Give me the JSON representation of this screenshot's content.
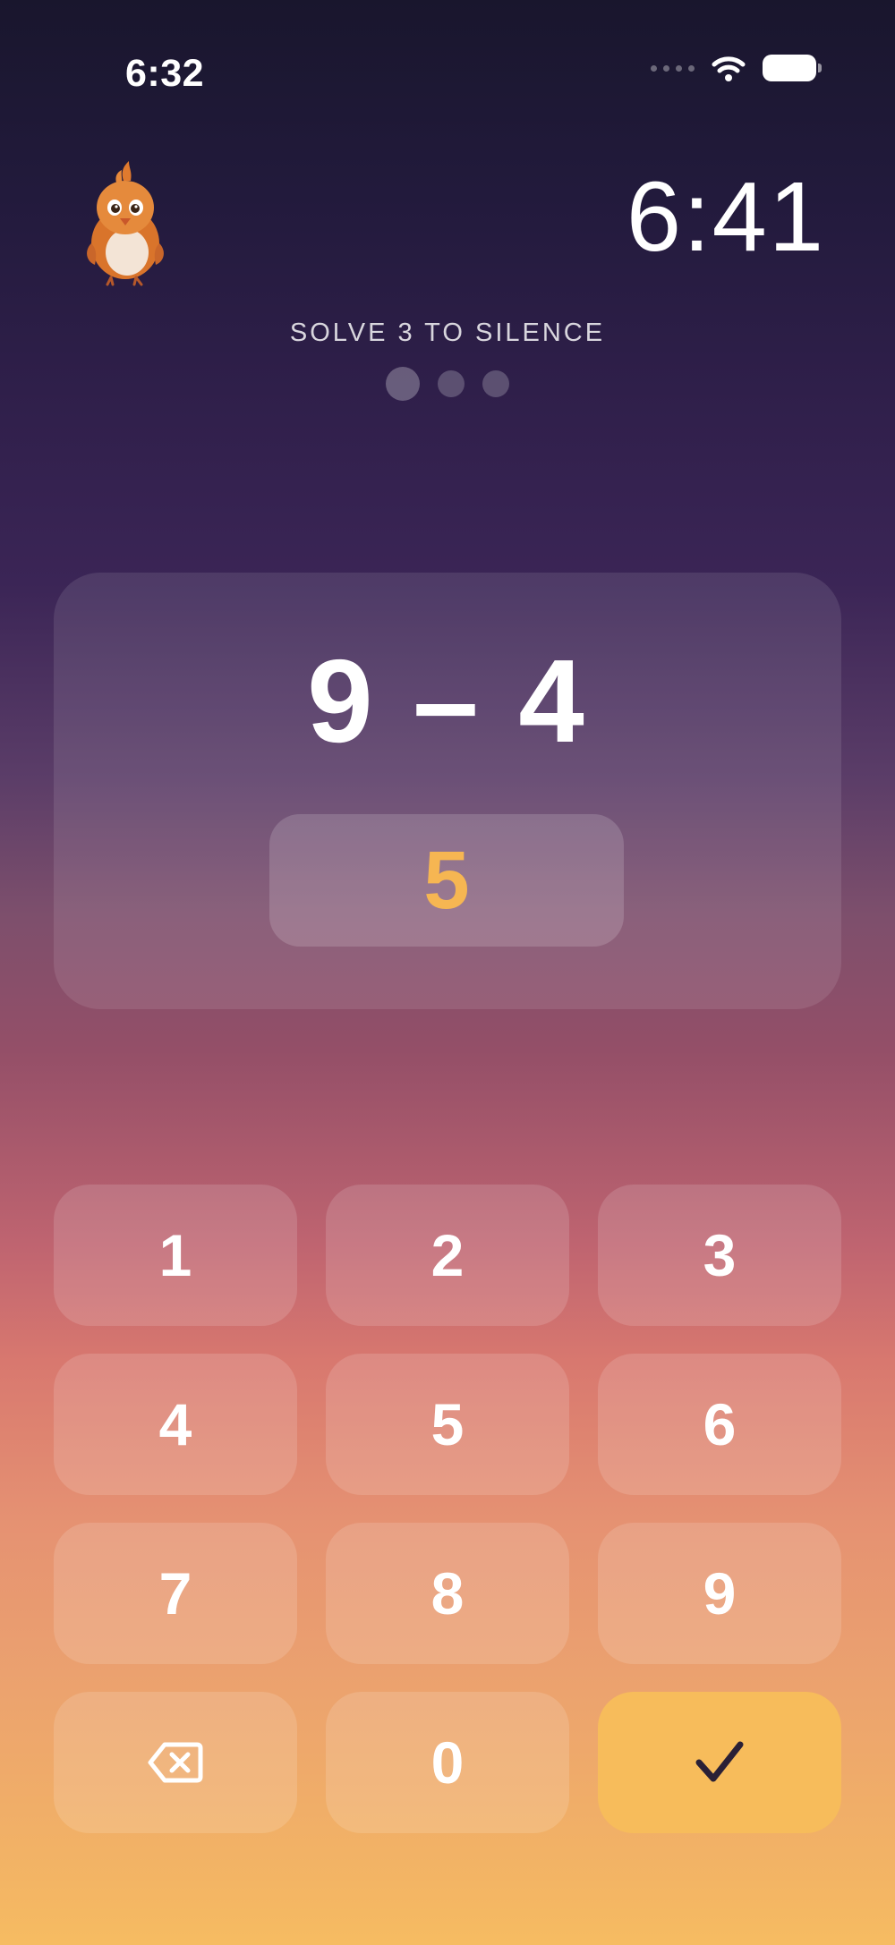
{
  "status_bar": {
    "time": "6:32",
    "icons": [
      "signal-dots-icon",
      "wifi-icon",
      "battery-icon"
    ]
  },
  "mascot": {
    "icon": "bird-mascot-icon"
  },
  "alarm": {
    "time": "6:41"
  },
  "challenge": {
    "instruction": "SOLVE 3 TO SILENCE",
    "total_problems": 3,
    "current_index": 1
  },
  "problem": {
    "equation": "9 – 4",
    "answer": "5"
  },
  "keypad": {
    "keys": {
      "k1": "1",
      "k2": "2",
      "k3": "3",
      "k4": "4",
      "k5": "5",
      "k6": "6",
      "k7": "7",
      "k8": "8",
      "k9": "9",
      "k0": "0"
    },
    "delete_icon": "backspace-icon",
    "submit_icon": "checkmark-icon"
  },
  "colors": {
    "answer": "#f6b652",
    "submit": "#f7bc5b",
    "checkmark": "#2a2036"
  }
}
